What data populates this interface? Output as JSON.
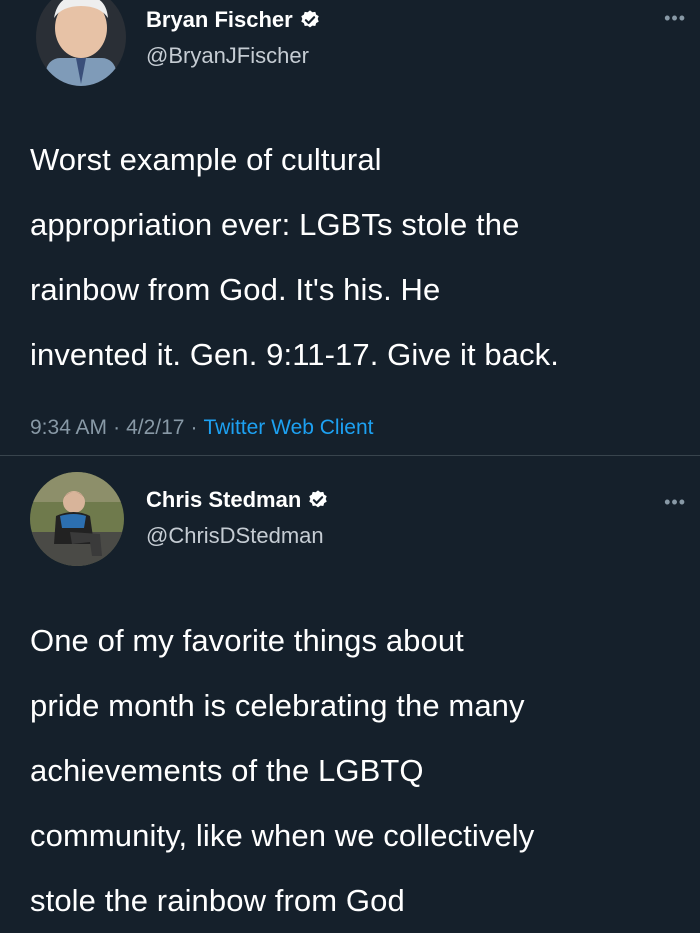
{
  "tweets": [
    {
      "display_name": "Bryan Fischer",
      "handle": "@BryanJFischer",
      "text": "Worst example of cultural\nappropriation ever: LGBTs stole the\nrainbow from God. It's his. He\ninvented it. Gen. 9:11-17. Give it back.",
      "time": "9:34 AM",
      "date": "4/2/17",
      "client": "Twitter Web Client",
      "separator": "·",
      "more": "•••",
      "verified": true
    },
    {
      "display_name": "Chris Stedman",
      "handle": "@ChrisDStedman",
      "text": "One of my favorite things about\npride month is celebrating the many\nachievements of the LGBTQ\ncommunity, like when we collectively\nstole the rainbow from God",
      "more": "•••",
      "verified": true
    }
  ],
  "colors": {
    "background": "#15202b",
    "text": "#ffffff",
    "secondary": "#8899a6",
    "link": "#1da1f2",
    "verified_badge": "#ffffff"
  },
  "icons": {
    "verified": "verified-badge-icon",
    "more": "more-options-icon"
  }
}
